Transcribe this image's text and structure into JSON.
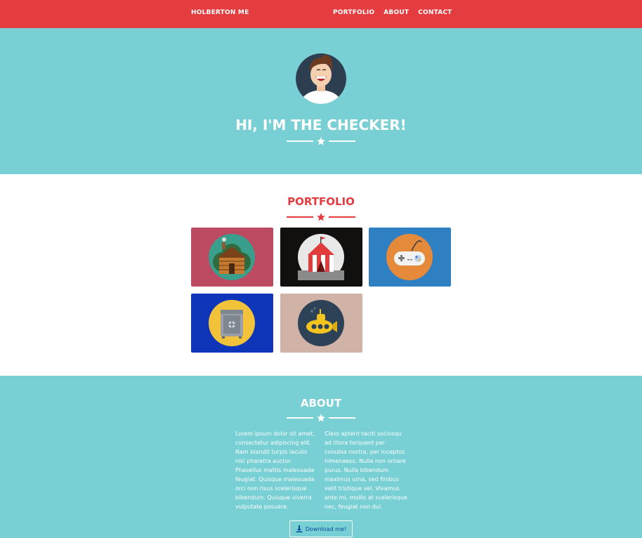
{
  "nav": {
    "brand": "HOLBERTON ME",
    "links": [
      "PORTFOLIO",
      "ABOUT",
      "CONTACT"
    ]
  },
  "hero": {
    "title": "HI, I'M THE CHECKER!"
  },
  "portfolio": {
    "title": "PORTFOLIO",
    "items": [
      {
        "icon": "cabin-icon",
        "bg": "#bc4b61"
      },
      {
        "icon": "circus-tent-icon",
        "bg": "#120f0f"
      },
      {
        "icon": "game-controller-icon",
        "bg": "#2f80c3"
      },
      {
        "icon": "safe-icon",
        "bg": "#0f35b8"
      },
      {
        "icon": "submarine-icon",
        "bg": "#d0b3a6"
      }
    ]
  },
  "about": {
    "title": "ABOUT",
    "left_text": "Lorem ipsum dolor sit amet, consectetur adipiscing elit. Nam blandit turpis iaculis nisl pharetra auctor. Phasellus mattis malesuada feugiat. Quisque malesuada orci non risus scelerisque bibendum. Quisque viverra vulputate posuere.",
    "right_text": "Class aptent taciti sociosqu ad litora torquent per conubia nostra, per inceptos himenaeos. Nulla non ornare purus. Nulla bibendum maximus urna, sed finibus velit tristique vel. Vivamus ante mi, mollis at scelerisque nec, feugiat non dui.",
    "download_label": "Download me!"
  },
  "colors": {
    "primary": "#e43c3f",
    "teal": "#78cfd4",
    "white": "#ffffff"
  }
}
